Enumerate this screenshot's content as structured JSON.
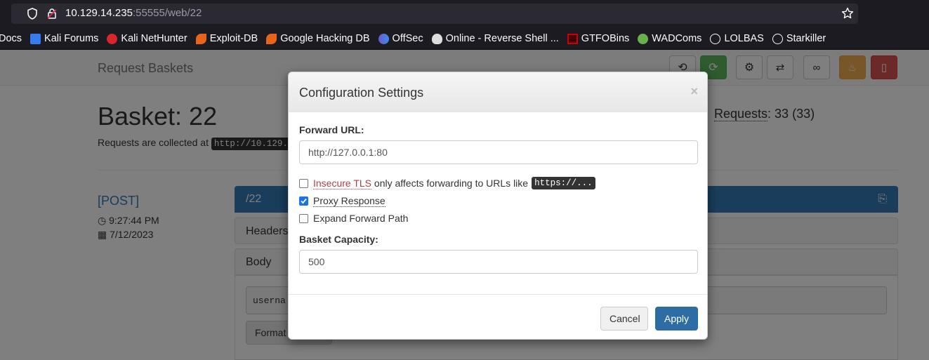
{
  "browser": {
    "url_host": "10.129.14.235",
    "url_rest": ":55555/web/22",
    "bookmarks": [
      {
        "label": "Docs",
        "icon": "docs-icon"
      },
      {
        "label": "Kali Forums",
        "icon": "kali-forums-icon"
      },
      {
        "label": "Kali NetHunter",
        "icon": "kali-nethunter-icon"
      },
      {
        "label": "Exploit-DB",
        "icon": "exploit-db-icon"
      },
      {
        "label": "Google Hacking DB",
        "icon": "google-hacking-db-icon"
      },
      {
        "label": "OffSec",
        "icon": "offsec-icon"
      },
      {
        "label": "Online - Reverse Shell ...",
        "icon": "skull-icon"
      },
      {
        "label": "GTFOBins",
        "icon": "gtfobins-icon"
      },
      {
        "label": "WADComs",
        "icon": "wadcoms-icon"
      },
      {
        "label": "LOLBAS",
        "icon": "globe-icon"
      },
      {
        "label": "Starkiller",
        "icon": "globe-icon"
      }
    ]
  },
  "navbar": {
    "brand": "Request Baskets"
  },
  "basket": {
    "title": "Basket: 22",
    "collected_prefix": "Requests are collected at",
    "collected_url": "http://10.129.",
    "requests_label": "Requests",
    "requests_count": ": 33 (33)"
  },
  "request": {
    "method": "[POST]",
    "time": "9:27:44 PM",
    "date": "7/12/2023",
    "path": "/22",
    "headers_label": "Headers",
    "body_label": "Body",
    "body_text": "userna",
    "format_button": "Format"
  },
  "modal": {
    "title": "Configuration Settings",
    "close": "×",
    "forward_url_label": "Forward URL:",
    "forward_url_value": "http://127.0.0.1:80",
    "insecure_tls_label": "Insecure TLS",
    "insecure_tls_desc": "only affects forwarding to URLs like",
    "insecure_tls_code": "https://...",
    "insecure_tls_checked": false,
    "proxy_response_label": "Proxy Response",
    "proxy_response_checked": true,
    "expand_path_label": "Expand Forward Path",
    "expand_path_checked": false,
    "capacity_label": "Basket Capacity:",
    "capacity_value": "500",
    "cancel": "Cancel",
    "apply": "Apply"
  },
  "colors": {
    "primary": "#337ab7",
    "success": "#5cb85c",
    "warning": "#f0ad4e",
    "danger": "#d9534f"
  }
}
